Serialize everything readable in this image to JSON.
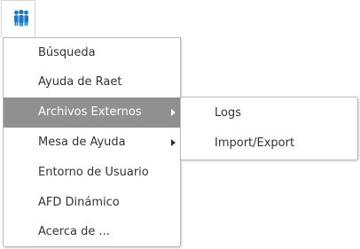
{
  "toolbar": {
    "users_icon": "users-group-icon",
    "accent_color": "#1a7bc4"
  },
  "menu": {
    "items": [
      {
        "label": "Búsqueda"
      },
      {
        "label": "Ayuda de Raet"
      },
      {
        "label": "Archivos Externos",
        "has_submenu": true,
        "active": true
      },
      {
        "label": "Mesa de Ayuda",
        "has_submenu": true
      },
      {
        "label": "Entorno de Usuario"
      },
      {
        "label": "AFD Dinámico"
      },
      {
        "label": "Acerca de ..."
      }
    ],
    "highlight_color": "#909090"
  },
  "submenu": {
    "items": [
      {
        "label": "Logs"
      },
      {
        "label": "Import/Export"
      }
    ]
  }
}
